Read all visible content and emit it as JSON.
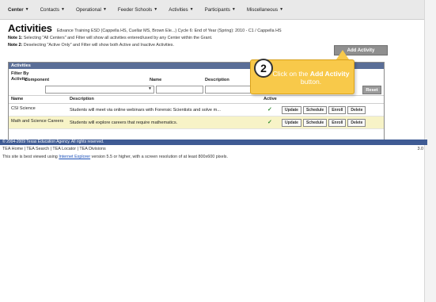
{
  "nav": {
    "items": [
      {
        "label": "Center"
      },
      {
        "label": "Contacts"
      },
      {
        "label": "Operational"
      },
      {
        "label": "Feeder Schools"
      },
      {
        "label": "Activities"
      },
      {
        "label": "Participants"
      },
      {
        "label": "Miscellaneous"
      }
    ]
  },
  "page": {
    "title": "Activities",
    "subtitle": "Edvance Training ESD (Cappella HS, Cuellar MS, Brown Ele...) Cycle 6: End of Year (Spring): 2010 - C1 / Cappella HS",
    "note1_label": "Note 1:",
    "note1_text": "Selecting \"All Centers\" and Filter will show all activities entered/used by any Center within the Grant.",
    "note2_label": "Note 2:",
    "note2_text": "Deselecting \"Active Only\" and Filter will show both Active and Inactive Activities.",
    "add_activity_label": "Add Activity"
  },
  "panel": {
    "header": "Activities",
    "filter_label_1": "Filter By",
    "filter_label_2": "Activity:",
    "col_component": "Component",
    "col_name": "Name",
    "col_description": "Description",
    "reset_label": "Reset"
  },
  "table": {
    "headers": {
      "name": "Name",
      "description": "Description",
      "active": "Active"
    },
    "rows": [
      {
        "name": "CSI Science",
        "description": "Students will meet via online webinars with Forensic Scientists and solve m...",
        "active": "✓",
        "buttons": [
          "Update",
          "Schedule",
          "Enroll",
          "Delete"
        ]
      },
      {
        "name": "Math and Science Careers",
        "description": "Students will explore careers that require mathematics.",
        "active": "✓",
        "buttons": [
          "Update",
          "Schedule",
          "Enroll",
          "Delete"
        ]
      }
    ]
  },
  "footer": {
    "copyright": "© 2004-2009 Texas Education Agency. All rights reserved.",
    "links": "TEA Home | TEA Search | TEA Locator | TEA Divisions",
    "version": "3.0",
    "note_before": "This site is best viewed using",
    "note_link": "Internet Explorer",
    "note_after": "version 5.5 or higher, with a screen resolution of at least 800x600 pixels."
  },
  "callout": {
    "step": "2",
    "text_before": "Click on the",
    "text_bold": "Add Activity",
    "text_after": "button."
  },
  "colors": {
    "panel_header": "#5a6e97",
    "callout": "#f8c94a",
    "copyright_bar": "#3f5b94",
    "active_check": "#2e8b2e"
  }
}
